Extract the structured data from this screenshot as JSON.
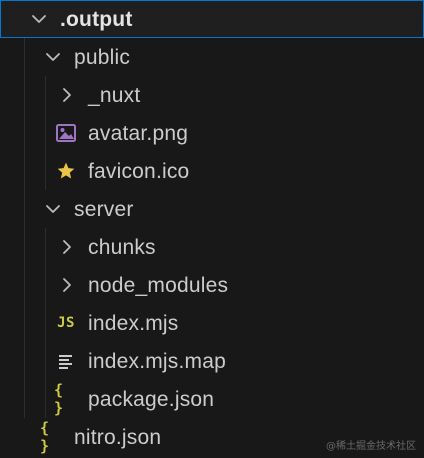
{
  "explorer": {
    "items": [
      {
        "label": ".output",
        "kind": "folder",
        "expanded": true,
        "selected": true
      },
      {
        "label": "public",
        "kind": "folder",
        "expanded": true
      },
      {
        "label": "_nuxt",
        "kind": "folder",
        "expanded": false
      },
      {
        "label": "avatar.png",
        "kind": "file",
        "icon": "image-icon"
      },
      {
        "label": "favicon.ico",
        "kind": "file",
        "icon": "star-icon"
      },
      {
        "label": "server",
        "kind": "folder",
        "expanded": true
      },
      {
        "label": "chunks",
        "kind": "folder",
        "expanded": false
      },
      {
        "label": "node_modules",
        "kind": "folder",
        "expanded": false
      },
      {
        "label": "index.mjs",
        "kind": "file",
        "icon": "javascript-icon",
        "icon_text": "JS"
      },
      {
        "label": "index.mjs.map",
        "kind": "file",
        "icon": "lines-icon"
      },
      {
        "label": "package.json",
        "kind": "file",
        "icon": "braces-icon",
        "icon_text": "{ }"
      },
      {
        "label": "nitro.json",
        "kind": "file",
        "icon": "braces-icon",
        "icon_text": "{ }"
      }
    ]
  },
  "watermark": "@稀土掘金技术社区",
  "colors": {
    "background": "#181818",
    "selection_border": "#0078d4",
    "text": "#cccccc",
    "js_yellow": "#cbcb41",
    "json_yellow": "#cbcb41",
    "star_yellow": "#e8c547",
    "image_purple": "#a074c4",
    "chevron": "#bbbbbb"
  }
}
